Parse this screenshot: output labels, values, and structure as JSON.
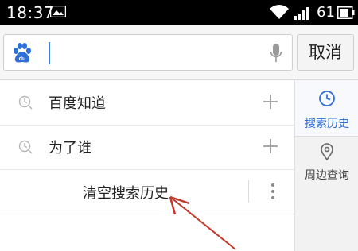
{
  "status_bar": {
    "time": "18:37",
    "battery_level": "61"
  },
  "search": {
    "placeholder": "",
    "value": "",
    "cancel_label": "取消"
  },
  "history": {
    "items": [
      {
        "label": "百度知道"
      },
      {
        "label": "为了谁"
      }
    ],
    "clear_label": "清空搜索历史"
  },
  "sidebar": {
    "tabs": [
      {
        "label": "搜索历史",
        "icon": "clock-icon",
        "active": true
      },
      {
        "label": "周边查询",
        "icon": "location-pin-icon",
        "active": false
      }
    ]
  },
  "colors": {
    "accent": "#2f6fd8",
    "annotation_arrow": "#c0392b"
  }
}
